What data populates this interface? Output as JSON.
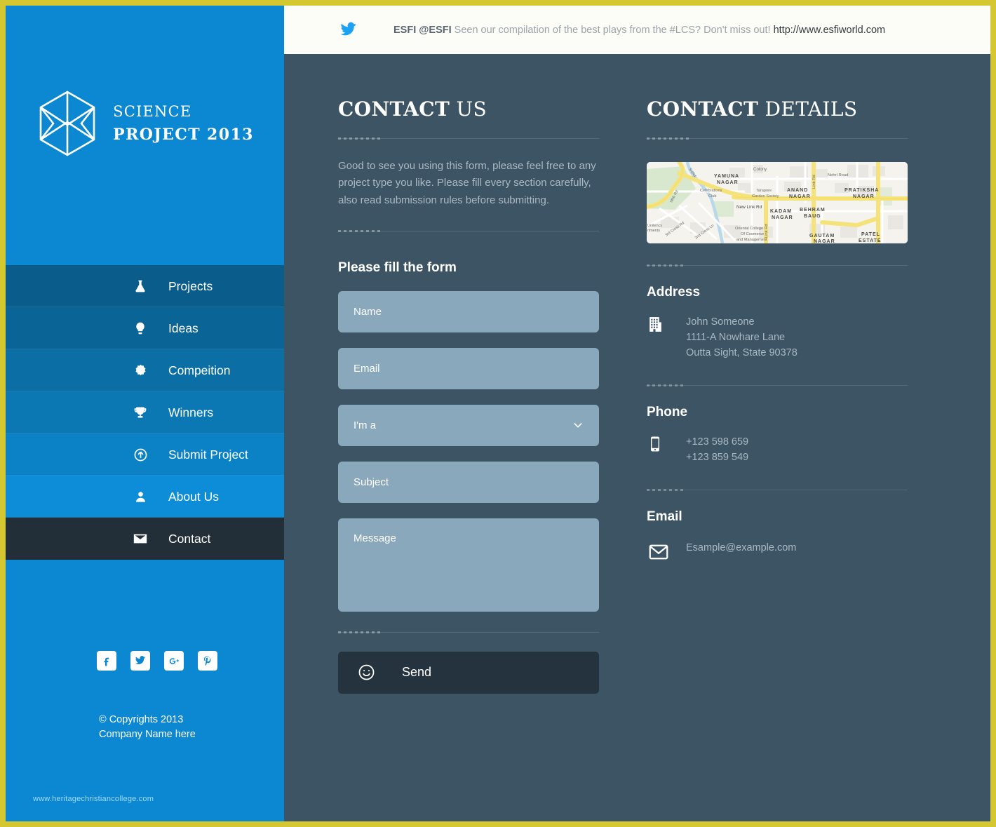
{
  "theme": {
    "frame_border": "#d4c731",
    "sidebar_blue": "#0c87d2",
    "main_bg": "#3d5464",
    "field_bg": "#8aa8bc",
    "send_bg": "#24333d",
    "active_nav": "#232f38"
  },
  "twitter": {
    "icon": "twitter-icon",
    "handle": "ESFI @ESFI",
    "message": "Seen our compilation of the best plays from the #LCS? Don't miss out!",
    "link": "http://www.esfiworld.com"
  },
  "brand": {
    "logo_icon": "hexagon-wireframe-logo",
    "line1": "SCIENCE",
    "line2": "PROJECT 2013"
  },
  "nav": {
    "items": [
      {
        "label": "Projects",
        "icon": "flask-icon",
        "active": false
      },
      {
        "label": "Ideas",
        "icon": "lightbulb-icon",
        "active": false
      },
      {
        "label": "Compeition",
        "icon": "badge-icon",
        "active": false
      },
      {
        "label": "Winners",
        "icon": "trophy-icon",
        "active": false
      },
      {
        "label": "Submit Project",
        "icon": "upload-circle-icon",
        "active": false
      },
      {
        "label": "About Us",
        "icon": "user-icon",
        "active": false
      },
      {
        "label": "Contact",
        "icon": "envelope-icon",
        "active": true
      }
    ]
  },
  "social": {
    "items": [
      {
        "name": "facebook-icon",
        "glyph": "f"
      },
      {
        "name": "twitter-icon",
        "glyph": "t"
      },
      {
        "name": "googleplus-icon",
        "glyph": "g+"
      },
      {
        "name": "pinterest-icon",
        "glyph": "p"
      }
    ]
  },
  "footer": {
    "copyright_line1": "© Copyrights 2013",
    "copyright_line2": "Company Name here",
    "watermark": "www.heritagechristiancollege.com"
  },
  "contact_us": {
    "title_bold": "CONTACT",
    "title_light": " US",
    "intro": "Good to see you using this form, please feel free to any project type you like. Please fill every section carefully, also read submission rules before submitting.",
    "form_subtitle": "Please fill the form",
    "fields": [
      {
        "name": "name-field",
        "placeholder": "Name",
        "value": "",
        "type": "text"
      },
      {
        "name": "email-field",
        "placeholder": "Email",
        "value": "",
        "type": "text"
      },
      {
        "name": "role-select",
        "placeholder": "I'm a",
        "value": "",
        "type": "select"
      },
      {
        "name": "subject-field",
        "placeholder": "Subject",
        "value": "",
        "type": "text"
      },
      {
        "name": "message-field",
        "placeholder": "Message",
        "value": "",
        "type": "textarea"
      }
    ],
    "send_label": "Send",
    "send_icon": "smiley-icon"
  },
  "contact_details": {
    "title_bold": "CONTACT",
    "title_light": " DETAILS",
    "map": {
      "name": "location-map",
      "labels": [
        "YAMUNA NAGAR",
        "Colony",
        "Celebrations Club",
        "Tarapore Garden Society",
        "ANAND NAGAR",
        "Link Rd",
        "Nehru Road",
        "PRATIKSHA NAGAR",
        "New Link Rd",
        "KADAM NAGAR",
        "BEHRAM BAUG",
        "3rd Cross Rd",
        "2nd Cross Ln",
        "Oriental College Of Commerce and Management",
        "GAUTAM NAGAR",
        "PATEL ESTATE",
        "Mhb Rd"
      ]
    },
    "sections": [
      {
        "heading": "Address",
        "icon": "building-icon",
        "lines": [
          "John Someone",
          "1111-A Nowhare Lane",
          "Outta Sight, State 90378"
        ]
      },
      {
        "heading": "Phone",
        "icon": "mobile-icon",
        "lines": [
          "+123 598 659",
          "+123 859 549"
        ]
      },
      {
        "heading": "Email",
        "icon": "envelope-icon",
        "lines": [
          "Esample@example.com"
        ]
      }
    ]
  }
}
